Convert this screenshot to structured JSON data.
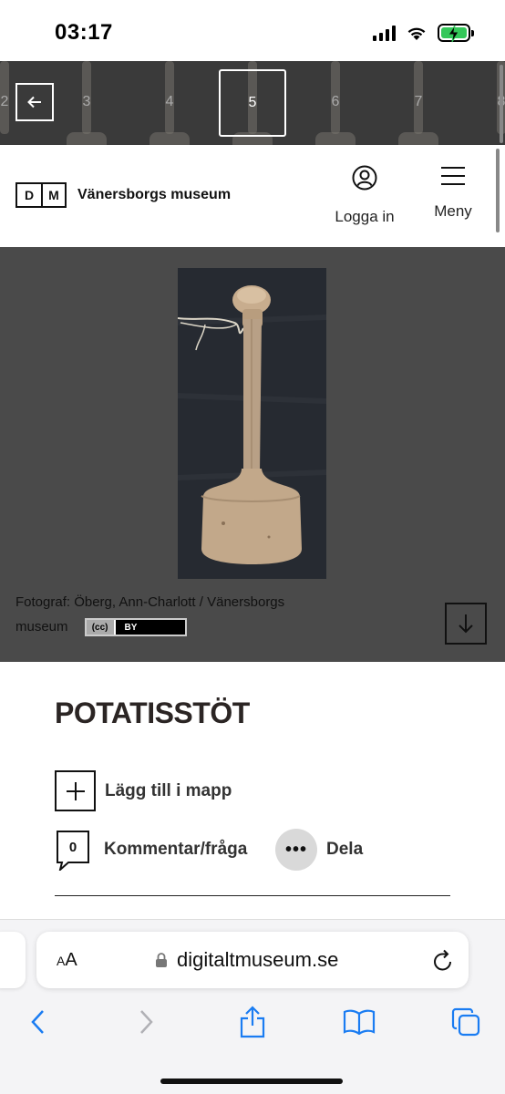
{
  "status_bar": {
    "time": "03:17"
  },
  "thumbnails": {
    "items": [
      "2",
      "3",
      "4",
      "5",
      "6",
      "7",
      "8"
    ],
    "active": "5"
  },
  "header": {
    "logo_letters": [
      "D",
      "M"
    ],
    "museum_name": "Vänersborgs museum",
    "login_label": "Logga in",
    "menu_label": "Meny"
  },
  "image": {
    "credit_line1": "Fotograf: Öberg, Ann-Charlott / Vänersborgs",
    "credit_line2": "museum",
    "license_cc": "(cc)",
    "license_by": "BY"
  },
  "content": {
    "title": "POTATISSTÖT",
    "add_to_folder": "Lägg till i mapp",
    "comment_count": "0",
    "comment_label": "Kommentar/fråga",
    "share_dots": "•••",
    "share_label": "Dela"
  },
  "browser": {
    "text_size_big": "A",
    "text_size_small": "A",
    "url": "digitaltmuseum.se"
  },
  "colors": {
    "image_bg": "#4a4a4a",
    "strip_bg": "#3a3a3a",
    "title": "#2b2524",
    "ios_blue": "#1a7cf2",
    "battery_green": "#34c759"
  }
}
